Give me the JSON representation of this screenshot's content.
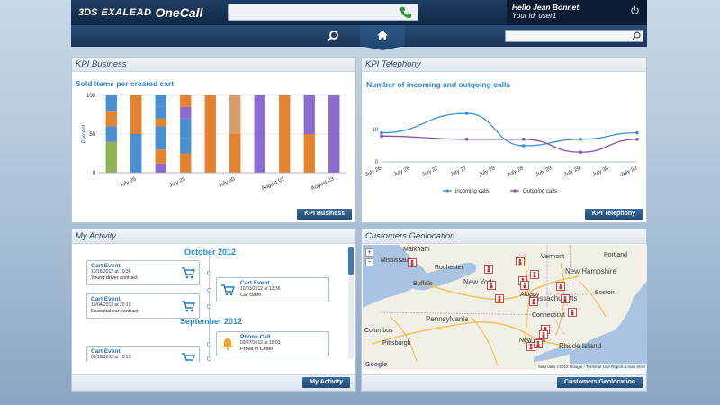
{
  "header": {
    "logo_ds": "3DS",
    "logo_brand": "EXALEAD",
    "logo_product": "OneCall",
    "greeting": "Hello Jean Bonnet",
    "user_id": "Your id: user1"
  },
  "kpi_business": {
    "title": "KPI Business",
    "chart_title": "Sold items per created cart",
    "button": "KPI Business"
  },
  "kpi_telephony": {
    "title": "KPI Telephony",
    "chart_title": "Number of incoming and outgoing calls",
    "button": "KPI Telephony"
  },
  "activity": {
    "title": "My Activity",
    "button": "My Activity",
    "months": [
      "October 2012",
      "September 2012"
    ],
    "events": [
      {
        "title": "Cart Event",
        "date": "10/16/2012 at 10:36",
        "desc": "Young driver contract",
        "side": "left",
        "icon": "cart-icon"
      },
      {
        "title": "Cart Event",
        "date": "10/03/2012 at 13:36",
        "desc": "Car claim",
        "side": "right",
        "icon": "cart-icon"
      },
      {
        "title": "Cart Event",
        "date": "10/04/2012 at 20:10",
        "desc": "Essential car contract",
        "side": "left",
        "icon": "cart-icon"
      },
      {
        "title": "Phone Call",
        "date": "09/27/2012 at 15:03",
        "desc": "Prova in Celtel",
        "side": "right",
        "icon": "bell-icon"
      },
      {
        "title": "Cart Event",
        "date": "09/18/2012 at 10:33",
        "desc": "",
        "side": "left",
        "icon": "cart-icon"
      }
    ]
  },
  "geolocation": {
    "title": "Customers Geolocation",
    "button": "Customers Geolocation",
    "map_data_text": "Map data ©2012 Google - Terms of Use",
    "report_text": "Report a map error",
    "google": "Google",
    "zoom_in": "+",
    "zoom_out": "−",
    "labels": {
      "markham": "Markham",
      "mississauga": "Mississauga",
      "rochester": "Rochester",
      "buffalo": "Buffalo",
      "new_york": "New York",
      "vermont": "Vermont",
      "new_hampshire": "New Hampshire",
      "massachusetts": "Massachusetts",
      "connecticut": "Connecticut",
      "rhode_island": "Rhode Island",
      "pennsylvania": "Pennsylvania",
      "new_york_city": "New York",
      "pittsburgh": "Pittsburgh",
      "columbus": "Columbus",
      "portland": "Portland",
      "boston": "Boston",
      "albany": "Albany"
    }
  },
  "chart_data": [
    {
      "type": "bar",
      "title": "Sold items per created cart",
      "ylabel": "Percent",
      "ylim": [
        0,
        100
      ],
      "yticks": [
        0,
        50,
        100
      ],
      "categories": [
        "",
        "July 26",
        "",
        "July 28",
        "",
        "July 30",
        "",
        "August 01",
        "",
        "August 03"
      ],
      "xtick_labels": [
        "July 26",
        "July 28",
        "July 30",
        "August 01",
        "August 03"
      ],
      "stack_colors": [
        "#8db356",
        "#4a8fd1",
        "#e5822f",
        "#8b6bd0",
        "#d99a6c",
        "#3f78b4"
      ],
      "stacks": [
        [
          {
            "color": "#8db356",
            "value": 40
          },
          {
            "color": "#4a8fd1",
            "value": 20
          },
          {
            "color": "#e5822f",
            "value": 20
          },
          {
            "color": "#4a8fd1",
            "value": 20
          }
        ],
        [
          {
            "color": "#4a8fd1",
            "value": 50
          },
          {
            "color": "#e5822f",
            "value": 50
          }
        ],
        [
          {
            "color": "#8b6bd0",
            "value": 12
          },
          {
            "color": "#e5822f",
            "value": 18
          },
          {
            "color": "#4a8fd1",
            "value": 30
          },
          {
            "color": "#e5822f",
            "value": 10
          },
          {
            "color": "#4a8fd1",
            "value": 15
          },
          {
            "color": "#4a8fd1",
            "value": 15
          }
        ],
        [
          {
            "color": "#e5822f",
            "value": 25
          },
          {
            "color": "#4a8fd1",
            "value": 20
          },
          {
            "color": "#4a8fd1",
            "value": 25
          },
          {
            "color": "#8b6bd0",
            "value": 15
          },
          {
            "color": "#e5822f",
            "value": 15
          }
        ],
        [
          {
            "color": "#e5822f",
            "value": 100
          }
        ],
        [
          {
            "color": "#e5822f",
            "value": 50
          },
          {
            "color": "#d99a6c",
            "value": 50
          }
        ],
        [
          {
            "color": "#8b6bd0",
            "value": 100
          }
        ],
        [
          {
            "color": "#e5822f",
            "value": 100
          }
        ],
        [
          {
            "color": "#e5822f",
            "value": 50
          },
          {
            "color": "#8b6bd0",
            "value": 50
          }
        ],
        [
          {
            "color": "#8b6bd0",
            "value": 100
          }
        ]
      ]
    },
    {
      "type": "line",
      "title": "Number of incoming and outgoing calls",
      "ylim": [
        0,
        20
      ],
      "yticks": [
        0,
        10
      ],
      "x": [
        "July 26",
        "July 26",
        "July 27",
        "July 27",
        "July 28",
        "July 28",
        "July 29",
        "July 29",
        "July 30",
        "July 30"
      ],
      "xtick_labels": [
        "July 26",
        "July 26",
        "July 27",
        "July 27",
        "July 28",
        "July 28",
        "July 29",
        "July 29",
        "July 30",
        "July 30"
      ],
      "point_index": [
        0,
        3,
        5,
        7,
        9
      ],
      "series": [
        {
          "name": "incoming calls",
          "color": "#3a8fd0",
          "values": [
            9,
            15,
            5,
            7,
            9
          ]
        },
        {
          "name": "Outgoing calls",
          "color": "#8a4fa8",
          "values": [
            8,
            7,
            7,
            3,
            7
          ]
        }
      ],
      "legend": "bottom"
    }
  ]
}
